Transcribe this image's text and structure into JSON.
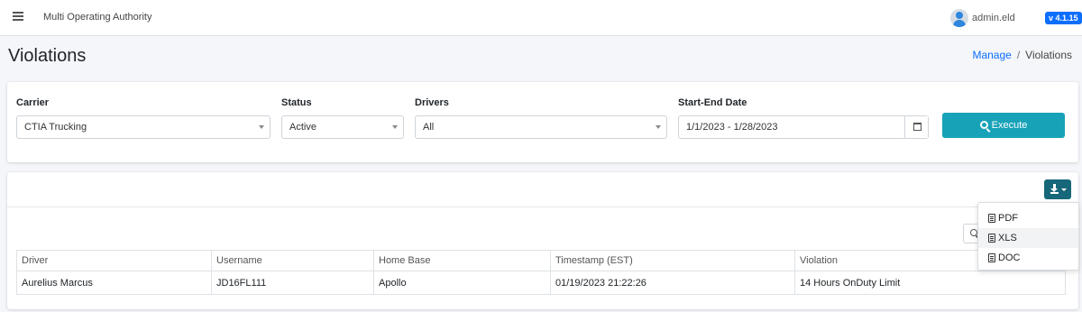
{
  "topbar": {
    "app_title": "Multi Operating Authority",
    "username": "admin.eld",
    "version": "v 4.1.15"
  },
  "page": {
    "title": "Violations",
    "breadcrumb": {
      "parent": "Manage",
      "separator": "/",
      "current": "Violations"
    }
  },
  "filters": {
    "carrier": {
      "label": "Carrier",
      "value": "CTIA Trucking"
    },
    "status": {
      "label": "Status",
      "value": "Active"
    },
    "drivers": {
      "label": "Drivers",
      "value": "All"
    },
    "date_range": {
      "label": "Start-End Date",
      "value": "1/1/2023 - 1/28/2023"
    },
    "execute_label": "Execute"
  },
  "export_menu": {
    "items": [
      {
        "label": "PDF",
        "icon": "file-pdf-icon"
      },
      {
        "label": "XLS",
        "icon": "file-excel-icon"
      },
      {
        "label": "DOC",
        "icon": "file-word-icon"
      }
    ]
  },
  "table": {
    "columns": [
      "Driver",
      "Username",
      "Home Base",
      "Timestamp (EST)",
      "Violation"
    ],
    "rows": [
      [
        "Aurelius Marcus",
        "JD16FL111",
        "Apollo",
        "01/19/2023 21:22:26",
        "14 Hours OnDuty Limit"
      ]
    ]
  },
  "colors": {
    "accent": "#17a2b8",
    "download_button": "#17677a",
    "version_badge": "#0d6efd",
    "link": "#0d6efd"
  }
}
